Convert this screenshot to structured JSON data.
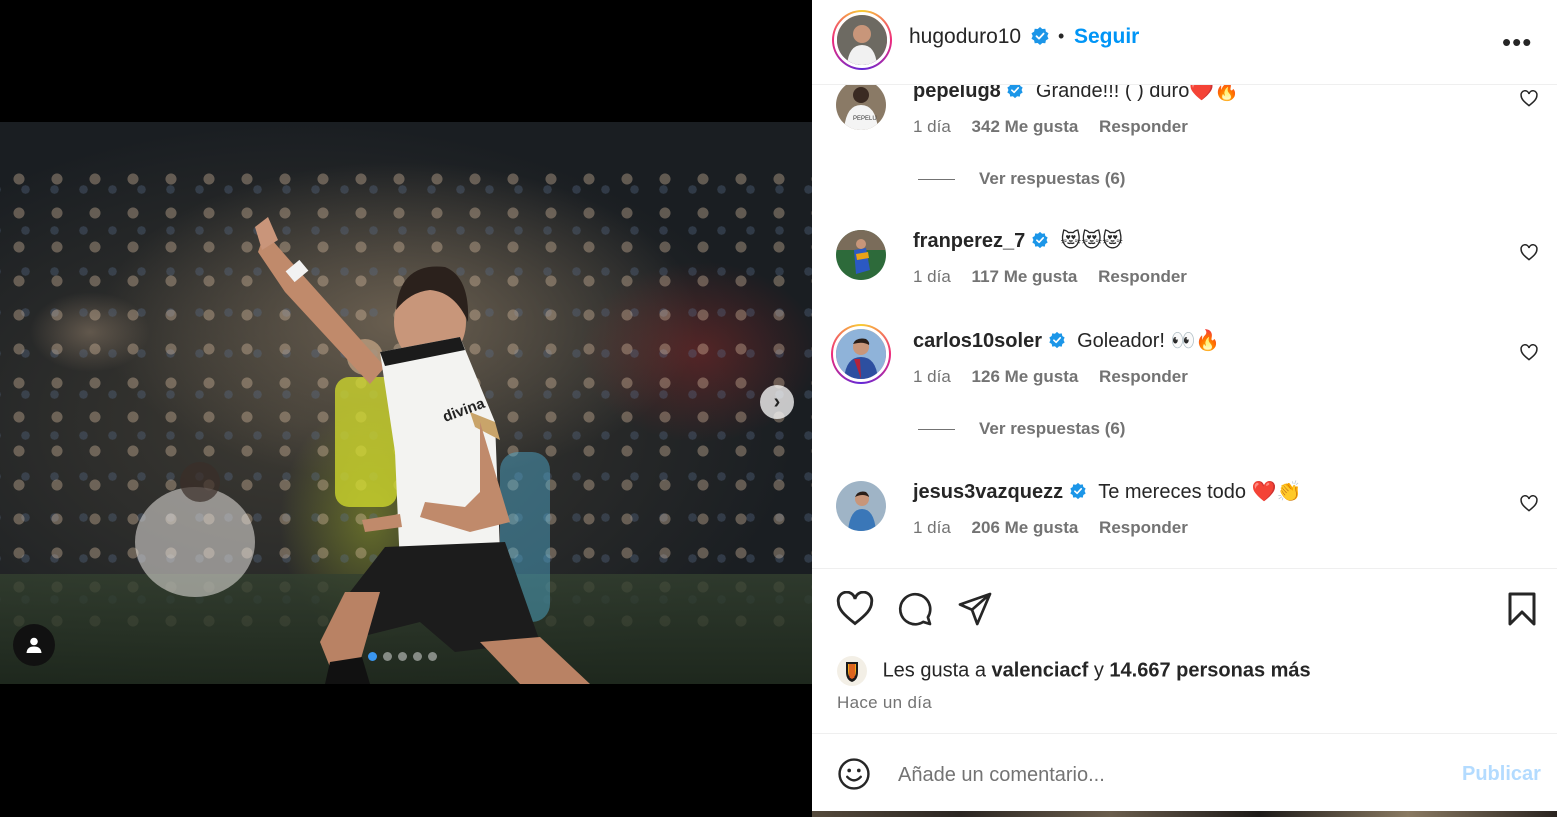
{
  "post": {
    "username": "hugoduro10",
    "follow_label": "Seguir",
    "separator": "•",
    "more_label": "•••",
    "carousel_total": 5,
    "carousel_active": 1
  },
  "comments": [
    {
      "username": "pepelug8",
      "text": "Grande!!! ( ) duro❤️🔥",
      "time": "1 día",
      "likes": "342 Me gusta",
      "reply": "Responder",
      "replies": "Ver respuestas (6)",
      "verified": true
    },
    {
      "username": "franperez_7",
      "text": "😻😻😻",
      "time": "1 día",
      "likes": "117 Me gusta",
      "reply": "Responder",
      "replies": "",
      "verified": true
    },
    {
      "username": "carlos10soler",
      "text": "Goleador! 👀🔥",
      "time": "1 día",
      "likes": "126 Me gusta",
      "reply": "Responder",
      "replies": "Ver respuestas (6)",
      "verified": true
    },
    {
      "username": "jesus3vazquezz",
      "text": "Te mereces todo ❤️👏",
      "time": "1 día",
      "likes": "206 Me gusta",
      "reply": "Responder",
      "replies": "",
      "verified": true
    }
  ],
  "likes_summary": {
    "prefix": "Les gusta a",
    "user": "valenciacf",
    "connector": "y",
    "count": "14.667 personas más"
  },
  "time_ago": "Hace un día",
  "comment_box": {
    "placeholder": "Añade un comentario...",
    "publish_label": "Publicar"
  },
  "colors": {
    "accent": "#0095f6",
    "verified": "#1c96e8",
    "publish_disabled": "#b3dbff",
    "carousel_active": "#3a97f0"
  },
  "icons": [
    "chevron-right-icon",
    "user-tag-icon",
    "verified-icon",
    "more-icon",
    "heart-icon",
    "comment-icon",
    "share-icon",
    "bookmark-icon",
    "emoji-icon"
  ]
}
